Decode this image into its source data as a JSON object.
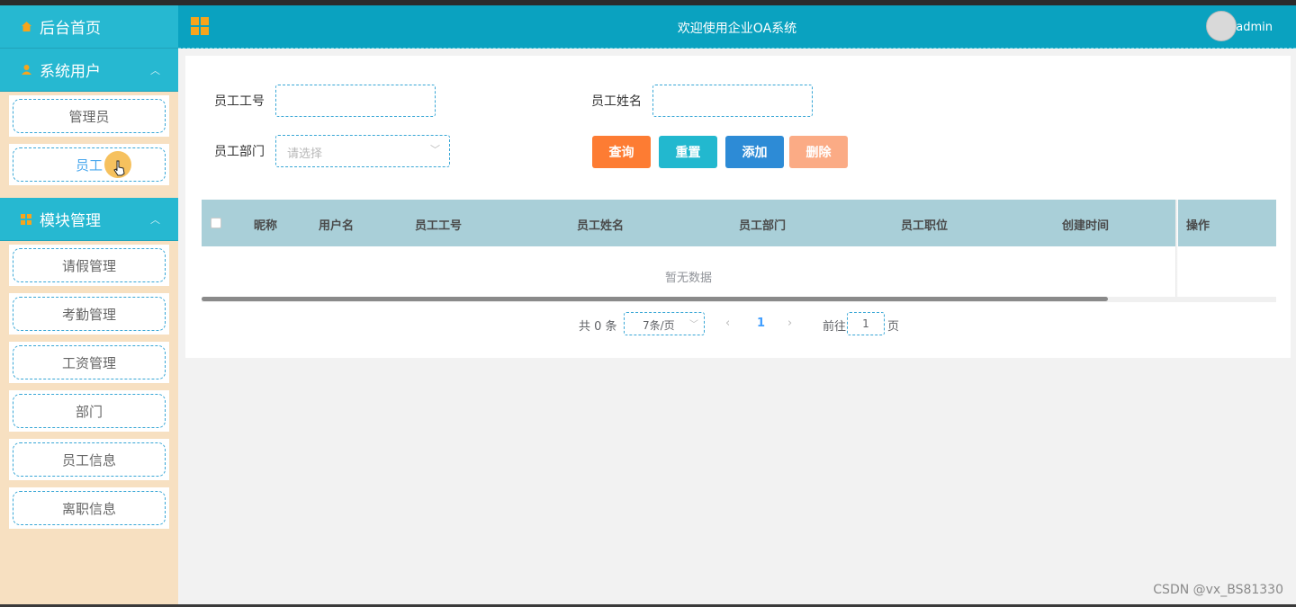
{
  "sidebar": {
    "home": "后台首页",
    "group_users": "系统用户",
    "user_items": [
      "管理员",
      "员工"
    ],
    "group_modules": "模块管理",
    "module_items": [
      "请假管理",
      "考勤管理",
      "工资管理",
      "部门",
      "员工信息",
      "离职信息"
    ]
  },
  "header": {
    "title": "欢迎使用企业OA系统",
    "user": "admin"
  },
  "search": {
    "emp_no_label": "员工工号",
    "emp_no_value": "",
    "emp_name_label": "员工姓名",
    "emp_name_value": "",
    "dept_label": "员工部门",
    "dept_placeholder": "请选择"
  },
  "buttons": {
    "query": "查询",
    "reset": "重置",
    "add": "添加",
    "delete": "删除"
  },
  "colors": {
    "query": "#fd7c33",
    "reset": "#22b8cf",
    "add": "#2d8bd6",
    "delete": "#fbab85",
    "header": "#0aa2c0",
    "sidebar_head": "#26b8d1",
    "sidebar_bg": "#f7e0c1"
  },
  "table": {
    "columns": [
      "昵称",
      "用户名",
      "员工工号",
      "员工姓名",
      "员工部门",
      "员工职位",
      "创建时间",
      "操作"
    ],
    "empty_text": "暂无数据"
  },
  "pagination": {
    "total": "共 0 条",
    "page_size": "7条/页",
    "current_page": "1",
    "goto_prefix": "前往",
    "goto_value": "1",
    "goto_suffix": "页"
  },
  "watermark": "CSDN @vx_BS81330"
}
